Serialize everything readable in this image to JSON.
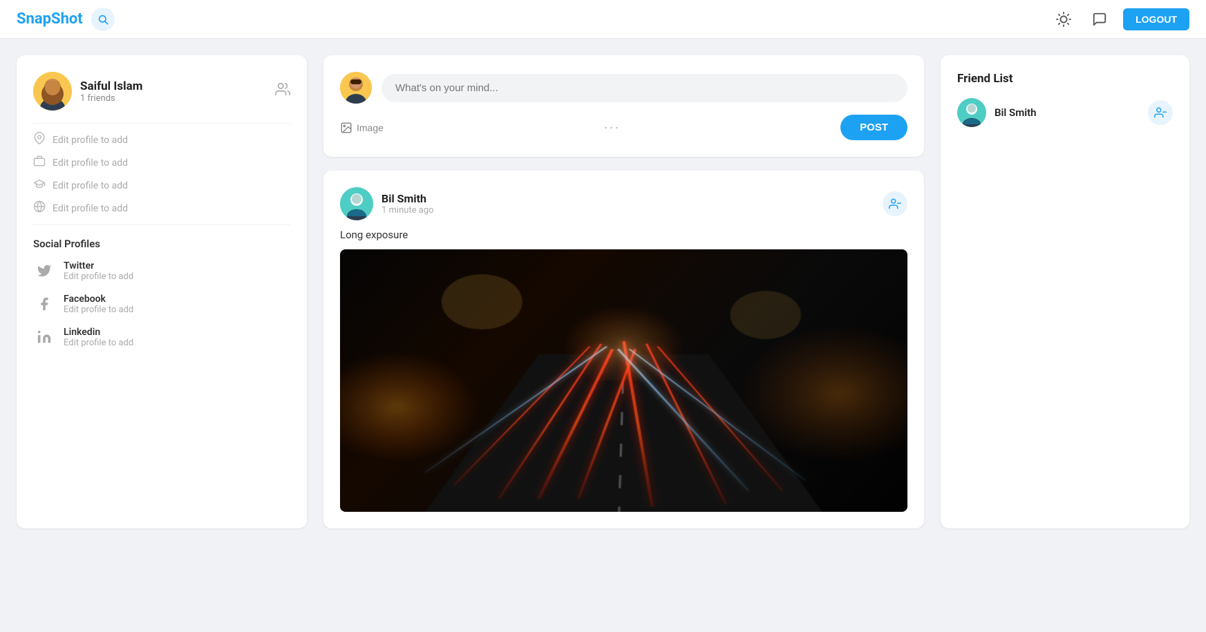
{
  "app": {
    "name": "SnapShot",
    "logout_label": "LOGOUT"
  },
  "header": {
    "theme_icon": "☀",
    "chat_icon": "💬",
    "logout_label": "LOGOUT"
  },
  "left_panel": {
    "user": {
      "name": "Saiful Islam",
      "friends_count": "1 friends"
    },
    "profile_fields": [
      {
        "icon": "📍",
        "label": "Edit profile to add"
      },
      {
        "icon": "💼",
        "label": "Edit profile to add"
      },
      {
        "icon": "🎓",
        "label": "Edit profile to add"
      },
      {
        "icon": "🌐",
        "label": "Edit profile to add"
      }
    ],
    "social_profiles_title": "Social Profiles",
    "social_profiles": [
      {
        "name": "Twitter",
        "sub": "Edit profile to add",
        "icon": "𝕏"
      },
      {
        "name": "Facebook",
        "sub": "Edit profile to add",
        "icon": "f"
      },
      {
        "name": "Linkedin",
        "sub": "Edit profile to add",
        "icon": "in"
      }
    ]
  },
  "post_box": {
    "placeholder": "What's on your mind...",
    "image_label": "Image",
    "dots": "···",
    "post_label": "POST"
  },
  "post": {
    "author": "Bil Smith",
    "time": "1 minute ago",
    "caption": "Long exposure"
  },
  "friend_list": {
    "title": "Friend List",
    "friends": [
      {
        "name": "Bil Smith"
      }
    ]
  }
}
